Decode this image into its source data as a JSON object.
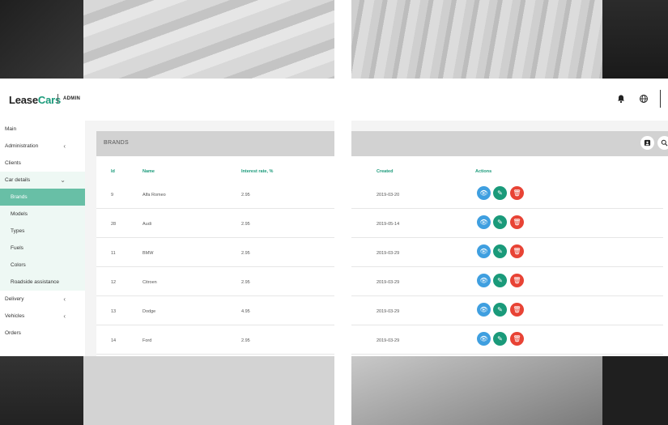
{
  "app": {
    "brand_prefix": "Lease",
    "brand_accent": "Cars",
    "role": "ADMIN",
    "accent_color": "#1a9a7a",
    "icons": [
      "bell-icon",
      "globe-icon"
    ]
  },
  "sidebar": {
    "items": [
      {
        "label": "Main"
      },
      {
        "label": "Administration",
        "chevron": "‹"
      },
      {
        "label": "Clients"
      },
      {
        "label": "Car details",
        "chevron": "⌄"
      },
      {
        "label": "Brands"
      },
      {
        "label": "Models"
      },
      {
        "label": "Types"
      },
      {
        "label": "Fuels"
      },
      {
        "label": "Colors"
      },
      {
        "label": "Roadside assistance"
      },
      {
        "label": "Delivery",
        "chevron": "‹"
      },
      {
        "label": "Vehicles",
        "chevron": "‹"
      },
      {
        "label": "Orders"
      }
    ],
    "active": "Brands"
  },
  "main": {
    "title": "BRANDS",
    "tools": [
      "image-icon",
      "search-icon"
    ],
    "table": {
      "headers": [
        "Id",
        "Name",
        "Interest rate, %",
        "Created",
        "Actions"
      ],
      "rows": [
        {
          "id": "9",
          "name": "Alfa Romeo",
          "rate": "2.95",
          "created": "2019-03-20"
        },
        {
          "id": "28",
          "name": "Audi",
          "rate": "2.95",
          "created": "2019-05-14"
        },
        {
          "id": "11",
          "name": "BMW",
          "rate": "2.95",
          "created": "2019-03-29"
        },
        {
          "id": "12",
          "name": "Citroen",
          "rate": "2.95",
          "created": "2019-03-29"
        },
        {
          "id": "13",
          "name": "Dodge",
          "rate": "4.95",
          "created": "2019-03-29"
        },
        {
          "id": "14",
          "name": "Ford",
          "rate": "2.95",
          "created": "2019-03-29"
        }
      ]
    }
  }
}
